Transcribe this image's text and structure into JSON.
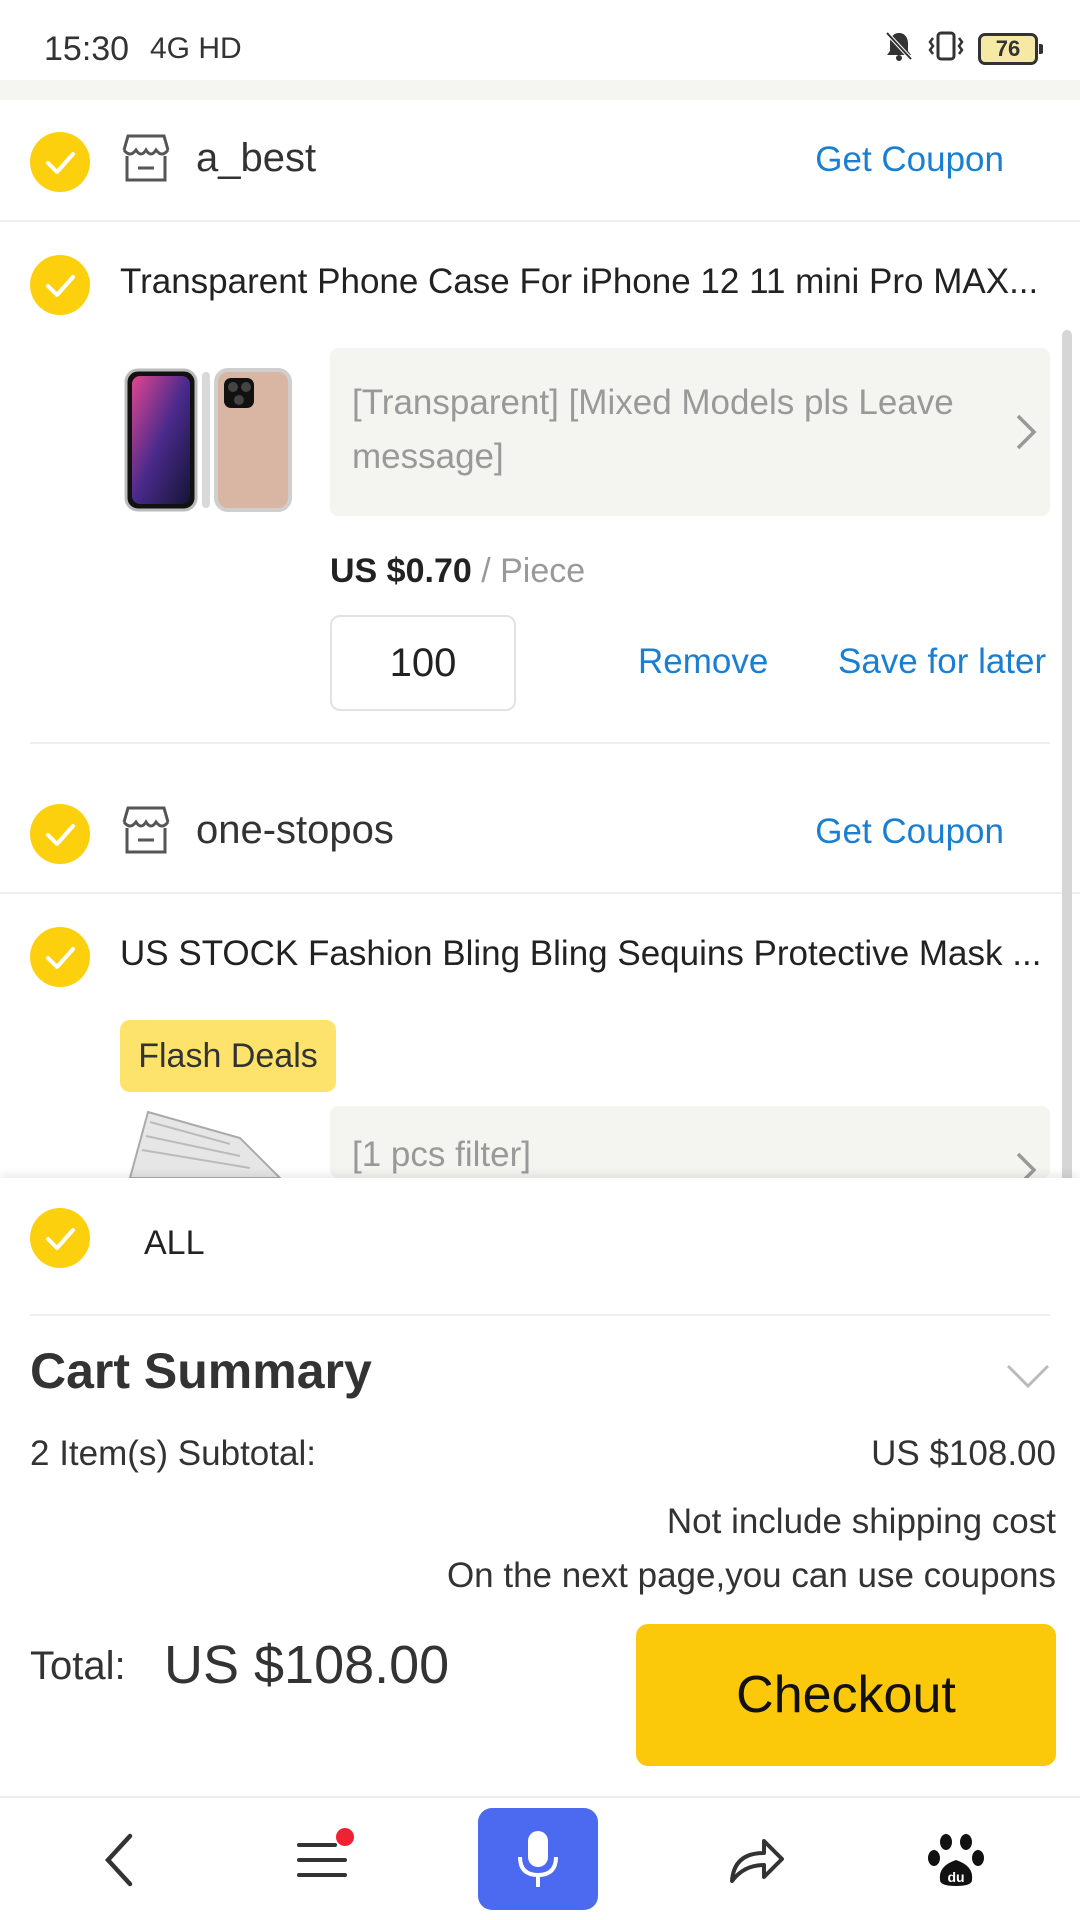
{
  "status_bar": {
    "time": "15:30",
    "network": "4G  HD",
    "battery": "76"
  },
  "stores": [
    {
      "name": "a_best",
      "coupon_label": "Get Coupon",
      "product": {
        "title": "Transparent Phone Case For iPhone 12 11 mini Pro MAX...",
        "variant": "[Transparent] [Mixed Models pls Leave message]",
        "price": "US $0.70",
        "unit": "/ Piece",
        "quantity": "100",
        "remove_label": "Remove",
        "save_label": "Save for later"
      }
    },
    {
      "name": "one-stopos",
      "coupon_label": "Get Coupon",
      "product": {
        "title": "US STOCK Fashion Bling Bling Sequins Protective Mask ...",
        "badge": "Flash Deals",
        "variant": "[1 pcs filter]"
      }
    }
  ],
  "summary": {
    "all_label": "ALL",
    "title": "Cart Summary",
    "subtotal_label": "2 Item(s) Subtotal:",
    "subtotal_value": "US $108.00",
    "note_shipping": "Not include shipping cost",
    "note_coupons": "On the next page,you can use coupons",
    "total_label": "Total:",
    "total_value": "US $108.00",
    "checkout_label": "Checkout"
  },
  "nav": {
    "items": [
      "back-icon",
      "menu-icon",
      "mic-icon",
      "share-icon",
      "baidu-paw-icon"
    ]
  },
  "colors": {
    "accent_yellow": "#fdd00e",
    "checkout_yellow": "#fcc80a",
    "link_blue": "#1a7fd1",
    "mic_blue": "#4b6af0",
    "flash_badge": "#fde36b"
  }
}
